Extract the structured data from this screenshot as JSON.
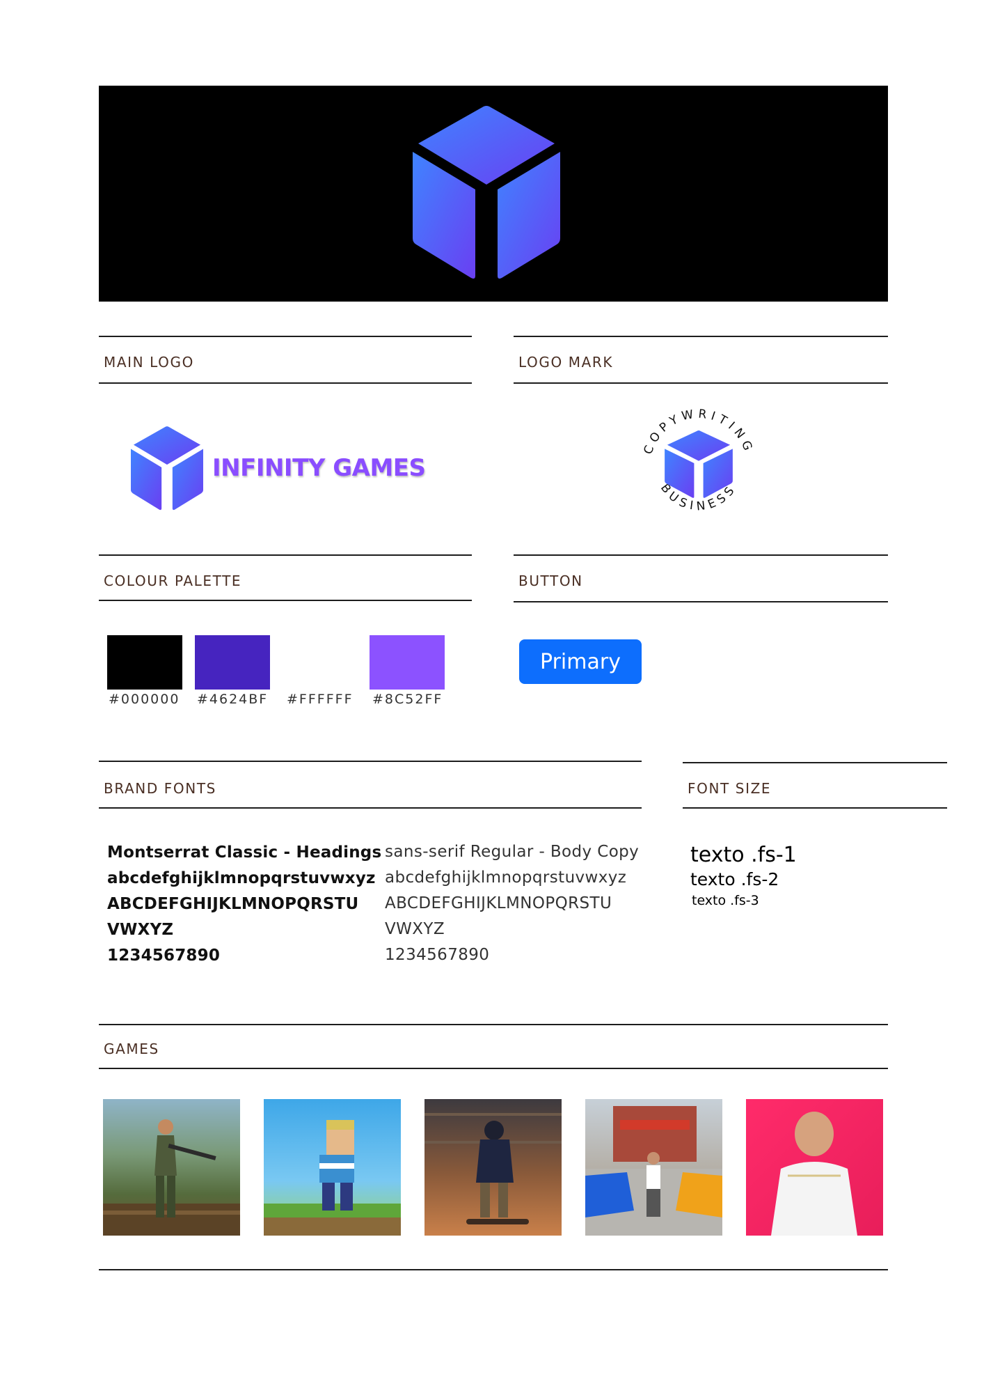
{
  "sections": {
    "main_logo": "MAIN LOGO",
    "logo_mark": "LOGO MARK",
    "colour_palette": "COLOUR PALETTE",
    "button": "BUTTON",
    "brand_fonts": "BRAND FONTS",
    "font_size": "FONT SIZE",
    "games": "GAMES"
  },
  "logo": {
    "wordmark": "INFINITY GAMES",
    "badge_top": "COPYWRITING",
    "badge_bottom": "BUSINESS",
    "gradient_start": "#3f84ff",
    "gradient_end": "#6a3ff2"
  },
  "palette": [
    {
      "hex": "#000000",
      "color": "#000000"
    },
    {
      "hex": "#4624BF",
      "color": "#4624BF"
    },
    {
      "hex": "#FFFFFF",
      "color": "#FFFFFF"
    },
    {
      "hex": "#8C52FF",
      "color": "#8C52FF"
    }
  ],
  "button": {
    "label": "Primary",
    "color": "#0d6efd"
  },
  "fonts": {
    "heading": {
      "name": "Montserrat Classic - Headings",
      "lower": "abcdefghijklmnopqrstuvwxyz",
      "upper1": "ABCDEFGHIJKLMNOPQRSTU",
      "upper2": "VWXYZ",
      "digits": "1234567890"
    },
    "body": {
      "name": "sans-serif Regular - Body Copy",
      "lower": "abcdefghijklmnopqrstuvwxyz",
      "upper1": "ABCDEFGHIJKLMNOPQRSTU",
      "upper2": "VWXYZ",
      "digits": "1234567890"
    }
  },
  "font_sizes": [
    "texto .fs-1",
    "texto .fs-2",
    "texto .fs-3"
  ]
}
